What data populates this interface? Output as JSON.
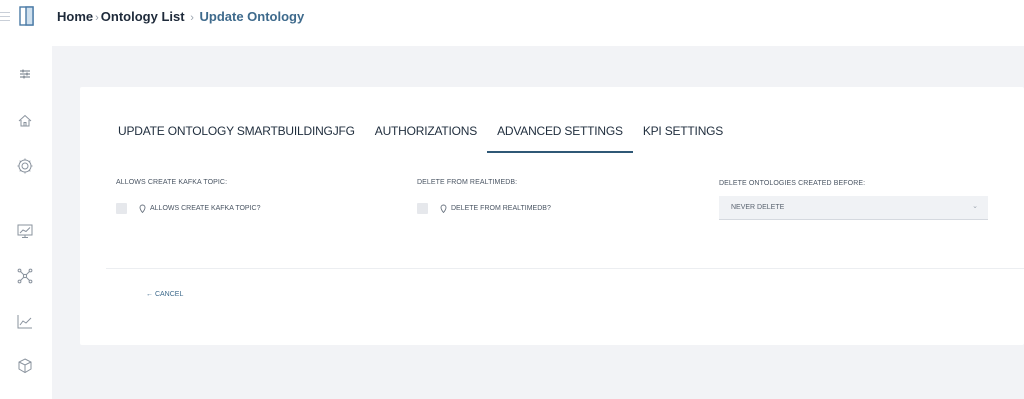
{
  "header": {
    "breadcrumb": {
      "home": "Home",
      "list": "Ontology List",
      "current": "Update Ontology",
      "separator": "›"
    }
  },
  "sidebar": {
    "icons": [
      "sliders-icon",
      "home-icon",
      "gear-icon",
      "monitor-chart-icon",
      "network-icon",
      "line-chart-icon",
      "cube-icon"
    ]
  },
  "tabs": [
    {
      "label": "UPDATE ONTOLOGY SMARTBUILDINGJFG",
      "active": false
    },
    {
      "label": "AUTHORIZATIONS",
      "active": false
    },
    {
      "label": "ADVANCED SETTINGS",
      "active": true
    },
    {
      "label": "KPI SETTINGS",
      "active": false
    }
  ],
  "fields": {
    "kafka": {
      "label": "ALLOWS CREATE KAFKA TOPIC:",
      "checkbox_label": "ALLOWS CREATE KAFKA TOPIC?"
    },
    "realtimedb": {
      "label": "DELETE FROM REALTIMEDB:",
      "checkbox_label": "DELETE FROM REALTIMEDB?"
    },
    "delete_before": {
      "label": "DELETE ONTOLOGIES CREATED BEFORE:",
      "selected": "NEVER DELETE"
    }
  },
  "actions": {
    "cancel_label": "← CANCEL"
  },
  "colors": {
    "accent": "#2f5876",
    "link": "#3e6a8c",
    "background": "#f2f3f6"
  }
}
